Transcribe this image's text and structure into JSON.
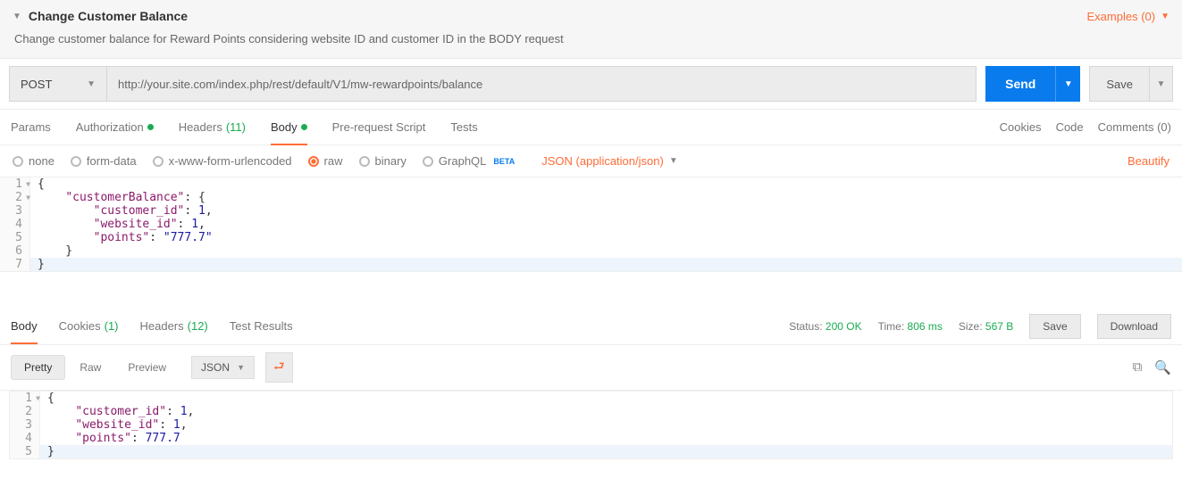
{
  "header": {
    "title": "Change Customer Balance",
    "examples_label": "Examples (0)",
    "description": "Change customer balance for Reward Points considering website ID and customer ID in the BODY request"
  },
  "request": {
    "method": "POST",
    "url": "http://your.site.com/index.php/rest/default/V1/mw-rewardpoints/balance",
    "send_label": "Send",
    "save_label": "Save"
  },
  "tabs": {
    "params": "Params",
    "auth": "Authorization",
    "headers": "Headers",
    "headers_count": "(11)",
    "body": "Body",
    "prerequest": "Pre-request Script",
    "tests": "Tests",
    "cookies": "Cookies",
    "code": "Code",
    "comments": "Comments (0)"
  },
  "body_opts": {
    "none": "none",
    "formdata": "form-data",
    "xwww": "x-www-form-urlencoded",
    "raw": "raw",
    "binary": "binary",
    "graphql": "GraphQL",
    "beta": "BETA",
    "content_type": "JSON (application/json)",
    "beautify": "Beautify"
  },
  "req_body": {
    "l1": "{",
    "l2_k": "\"customerBalance\"",
    "l2_r": ": {",
    "l3_k": "\"customer_id\"",
    "l3_v": "1",
    "l4_k": "\"website_id\"",
    "l4_v": "1",
    "l5_k": "\"points\"",
    "l5_v": "\"777.7\"",
    "l6": "    }",
    "l7": "}"
  },
  "resp_tabs": {
    "body": "Body",
    "cookies": "Cookies",
    "cookies_count": "(1)",
    "headers": "Headers",
    "headers_count": "(12)",
    "tests": "Test Results"
  },
  "resp_meta": {
    "status_l": "Status:",
    "status_v": "200 OK",
    "time_l": "Time:",
    "time_v": "806 ms",
    "size_l": "Size:",
    "size_v": "567 B",
    "save": "Save",
    "download": "Download"
  },
  "view": {
    "pretty": "Pretty",
    "raw": "Raw",
    "preview": "Preview",
    "lang": "JSON",
    "wrap_glyph": "⮐"
  },
  "resp_body": {
    "l1": "{",
    "l2_k": "\"customer_id\"",
    "l2_v": "1",
    "l3_k": "\"website_id\"",
    "l3_v": "1",
    "l4_k": "\"points\"",
    "l4_v": "777.7",
    "l5": "}"
  }
}
